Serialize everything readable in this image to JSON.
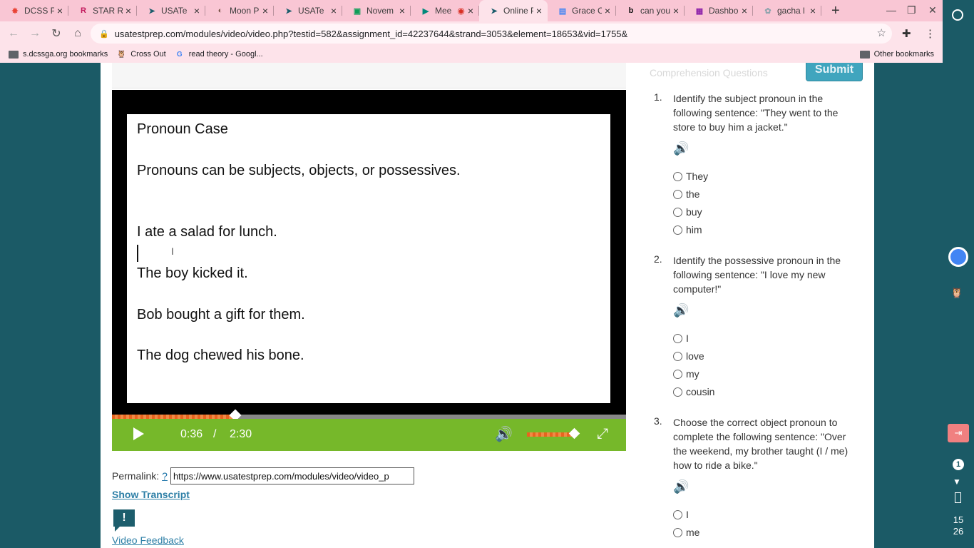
{
  "browser": {
    "tabs": [
      {
        "title": "DCSS P",
        "icon": "pinwheel-icon",
        "color": "#e94235",
        "active": false
      },
      {
        "title": "STAR R",
        "icon": "star-r-icon",
        "color": "#c2185b",
        "active": false
      },
      {
        "title": "USATe",
        "icon": "cursor-icon",
        "color": "#1c5d6c",
        "active": false
      },
      {
        "title": "Moon P",
        "icon": "moon-icon",
        "color": "#795548",
        "active": false
      },
      {
        "title": "USATe",
        "icon": "cursor-icon",
        "color": "#1c5d6c",
        "active": false
      },
      {
        "title": "Novem",
        "icon": "classroom-icon",
        "color": "#0f9d58",
        "active": false
      },
      {
        "title": "Mee",
        "icon": "meet-icon",
        "color": "#00897b",
        "active": false,
        "recording": true
      },
      {
        "title": "Online P",
        "icon": "cursor-icon",
        "color": "#1c5d6c",
        "active": true
      },
      {
        "title": "Grace C",
        "icon": "docs-icon",
        "color": "#4285f4",
        "active": false
      },
      {
        "title": "can you",
        "icon": "brainly-icon",
        "color": "#111111",
        "active": false
      },
      {
        "title": "Dashbo",
        "icon": "dashboard-icon",
        "color": "#8e24aa",
        "active": false
      },
      {
        "title": "gacha l",
        "icon": "gacha-icon",
        "color": "#90a4ae",
        "active": false
      }
    ],
    "url": "usatestprep.com/modules/video/video.php?testid=582&assignment_id=42237644&strand=3053&element=18653&vid=1755&",
    "bookmarks": [
      {
        "label": "s.dcssga.org bookmarks",
        "icon": "folder-icon"
      },
      {
        "label": "Cross Out",
        "icon": "cross-out-icon"
      },
      {
        "label": "read theory - Googl...",
        "icon": "google-icon"
      }
    ],
    "other_bookmarks": "Other bookmarks"
  },
  "page": {
    "comprehension_tab": "Comprehension Questions",
    "submit_label": "Submit",
    "slide": {
      "title": "Pronoun Case",
      "line1": "Pronouns can be subjects, objects, or possessives.",
      "line2": "I ate a salad for lunch.",
      "line3": "The boy kicked it.",
      "line4": "Bob bought a gift for them.",
      "line5": "The dog chewed his bone."
    },
    "player": {
      "current_time": "0:36",
      "separator": "/",
      "duration": "2:30",
      "progress_fraction": 0.24,
      "volume_fraction": 0.8,
      "accent_color": "#76b82a"
    },
    "permalink_label": "Permalink:",
    "permalink_help": "?",
    "permalink_value": "https://www.usatestprep.com/modules/video/video_p",
    "show_transcript": "Show Transcript",
    "feedback_glyph": "!",
    "video_feedback": "Video Feedback",
    "questions": [
      {
        "number": "1.",
        "text": "Identify the subject pronoun in the following sentence: \"They went to the store to buy him a jacket.\"",
        "options": [
          "They",
          "the",
          "buy",
          "him"
        ]
      },
      {
        "number": "2.",
        "text": "Identify the possessive pronoun in the following sentence: \"I love my new computer!\"",
        "options": [
          "I",
          "love",
          "my",
          "cousin"
        ]
      },
      {
        "number": "3.",
        "text": "Choose the correct object pronoun to complete the following sentence: \"Over the weekend, my brother taught (I / me) how to ride a bike.\"",
        "options": [
          "I",
          "me"
        ]
      }
    ]
  },
  "system": {
    "notification_count": "1",
    "clock_hour": "15",
    "clock_minute": "26"
  }
}
